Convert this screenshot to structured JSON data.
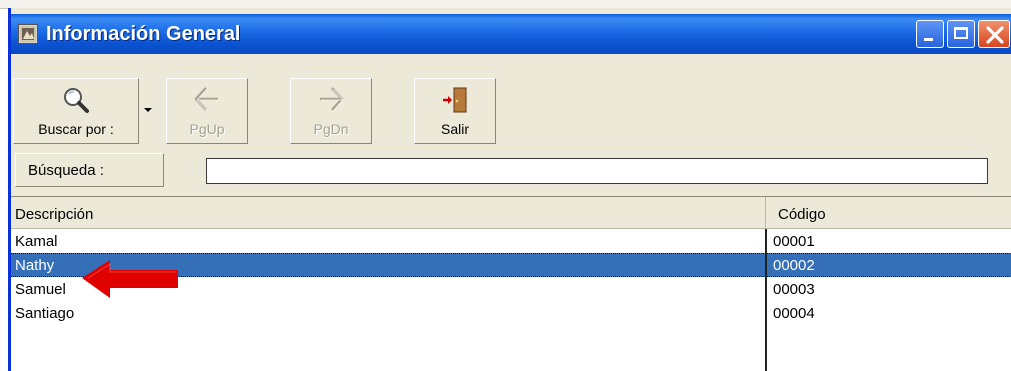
{
  "window": {
    "title": "Información General"
  },
  "toolbar": {
    "buttons": [
      {
        "label": "Buscar por :",
        "icon": "magnifier-icon",
        "enabled": true
      },
      {
        "label": "PgUp",
        "icon": "arrow-left-icon",
        "enabled": false
      },
      {
        "label": "PgDn",
        "icon": "arrow-right-icon",
        "enabled": false
      },
      {
        "label": "Salir",
        "icon": "exit-door-icon",
        "enabled": true
      }
    ]
  },
  "search": {
    "label": "Búsqueda :",
    "value": ""
  },
  "grid": {
    "columns": [
      "Descripción",
      "Código"
    ],
    "rows": [
      {
        "descripcion": "Kamal",
        "codigo": "00001",
        "selected": false
      },
      {
        "descripcion": "Nathy",
        "codigo": "00002",
        "selected": true
      },
      {
        "descripcion": "Samuel",
        "codigo": "00003",
        "selected": false
      },
      {
        "descripcion": "Santiago",
        "codigo": "00004",
        "selected": false
      }
    ]
  },
  "colors": {
    "titlebar": "#0a52d1",
    "selection": "#346fb8",
    "pointer_arrow": "#e00000",
    "window_face": "#ece9d8"
  }
}
